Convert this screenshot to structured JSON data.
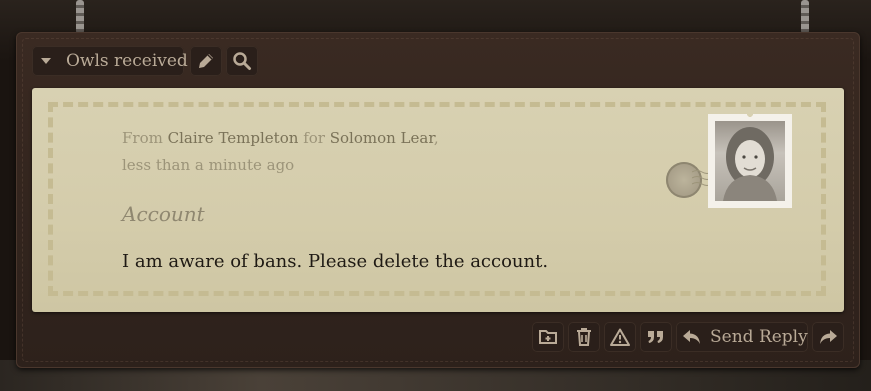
{
  "toolbar": {
    "folder_label": "Owls received",
    "edit_icon": "pencil-icon",
    "search_icon": "search-icon"
  },
  "letter": {
    "from_prefix": "From",
    "sender": "Claire Templeton",
    "for_text": "for",
    "recipient": "Solomon Lear",
    "recipient_suffix": ",",
    "time": "less than a minute ago",
    "subject": "Account",
    "body": "I am aware of bans. Please delete the account.",
    "stamp_icon": "portrait-stamp"
  },
  "actions": {
    "move_icon": "folder-move-icon",
    "delete_icon": "trash-icon",
    "report_icon": "warning-icon",
    "quote_icon": "quote-icon",
    "reply_label": "Send Reply",
    "forward_icon": "forward-icon"
  },
  "colors": {
    "board": "#33251e",
    "button": "#2a1f1a",
    "paper": "#d6cfb0",
    "airmail_dash": "#c5bb92",
    "button_text": "#b9aa97"
  }
}
